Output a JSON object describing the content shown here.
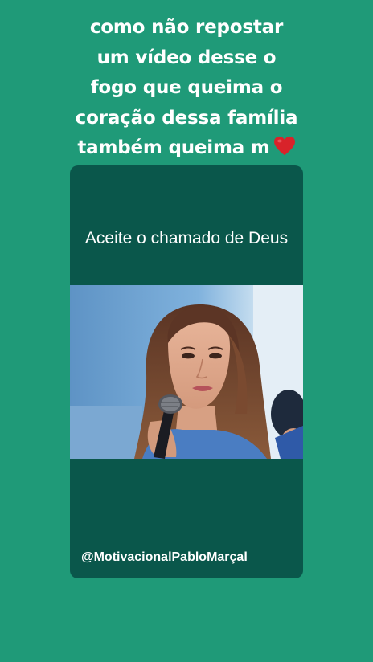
{
  "caption": {
    "lines": [
      "como não repostar",
      "um vídeo desse o",
      "fogo que queima o",
      "coração dessa família",
      "também queima m"
    ],
    "trailing_icon": "red-heart-emoji"
  },
  "card": {
    "title": "Aceite o chamado de Deus",
    "watermark": "@MotivacionalPabloMarçal"
  },
  "colors": {
    "background": "#1f9a78",
    "card": "#0a574b",
    "text": "#ffffff",
    "heart": "#d8232a"
  }
}
